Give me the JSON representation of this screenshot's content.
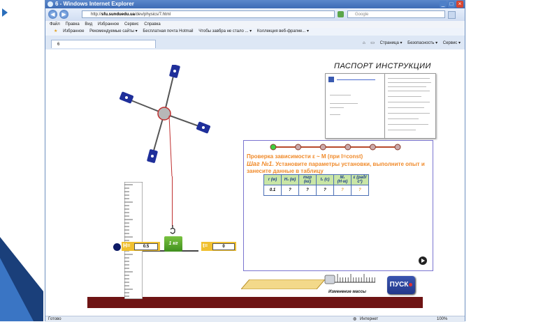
{
  "browser": {
    "title": "6 - Windows Internet Explorer",
    "url_prefix": "http://",
    "url_domain": "sfu.sunduedu.ua",
    "url_path": "/dev/physics/7.html",
    "search_placeholder": "Google",
    "menu": [
      "Файл",
      "Правка",
      "Вид",
      "Избранное",
      "Сервис",
      "Справка"
    ],
    "favorites": [
      "Избранное",
      "Рекомендуемые сайты ▾",
      "Бесплатная почта Hotmail",
      "Чтобы завбра не стало ... ▾",
      "Коллекция веб-фрагме... ▾"
    ],
    "tab_label": "6",
    "commands": [
      "Страница ▾",
      "Безопасность ▾",
      "Сервис ▾"
    ],
    "status_left": "Готово",
    "status_zone": "Интернет",
    "zoom": "100%"
  },
  "app": {
    "passport_title": "ПАСПОРТ  ИНСТРУКЦИИ",
    "step_heading": "Проверка зависимости ε ~ M  (при I=const)",
    "step_label": "Шаг №1.",
    "step_body": "Установите параметры установки, выполните опыт и занесите данные в таблицу",
    "table": {
      "headers": [
        "r (м)",
        "H₁ (м)",
        "mгр (кг)",
        "t₁ (с)",
        "M₁ (Н·м)",
        "ε (рад/с²)"
      ],
      "values": [
        "0.1",
        "?",
        "?",
        "?",
        "?",
        "?"
      ]
    },
    "h_label": "H=",
    "h_value": "0.5",
    "t_label": "t=",
    "t_value": "0",
    "weight_label": "1 кг",
    "mass_caption": "Изменение массы",
    "start_label": "ПУСК",
    "progress_steps": 6,
    "progress_current": 1
  }
}
